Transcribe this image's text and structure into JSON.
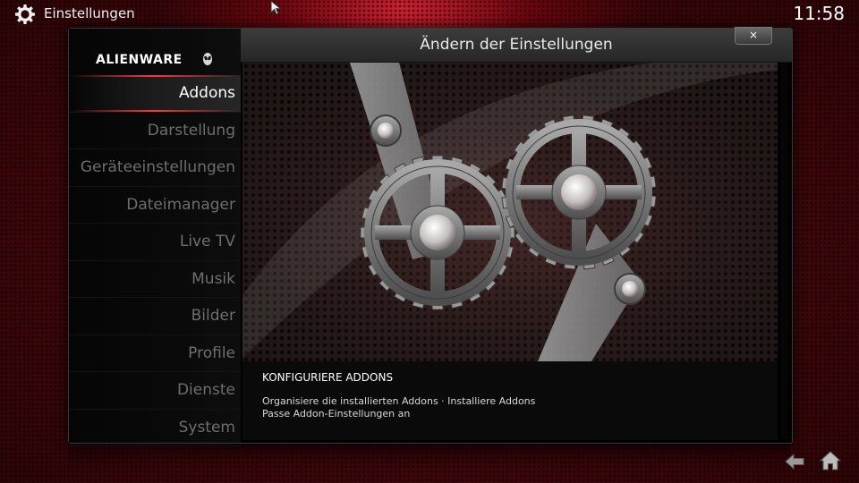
{
  "window": {
    "title": "Einstellungen",
    "clock": "11:58"
  },
  "brand": {
    "logo_text": "ALIENWARE",
    "accent_color": "#ff3838"
  },
  "sidebar": {
    "items": [
      {
        "label": "Addons",
        "active": true
      },
      {
        "label": "Darstellung",
        "active": false
      },
      {
        "label": "Geräteeinstellungen",
        "active": false
      },
      {
        "label": "Dateimanager",
        "active": false
      },
      {
        "label": "Live TV",
        "active": false
      },
      {
        "label": "Musik",
        "active": false
      },
      {
        "label": "Bilder",
        "active": false
      },
      {
        "label": "Profile",
        "active": false
      },
      {
        "label": "Dienste",
        "active": false
      },
      {
        "label": "System",
        "active": false
      }
    ]
  },
  "dialog": {
    "title": "Ändern der Einstellungen",
    "close_label": "×"
  },
  "description": {
    "title": "KONFIGURIERE ADDONS",
    "line1": "Organisiere die installierten Addons · Installiere Addons",
    "line2": "Passe Addon-Einstellungen an"
  },
  "icons": {
    "top_left": "settings-gear-icon",
    "artwork": "gears-artwork",
    "bottom_back": "back-arrow-icon",
    "bottom_home": "home-icon"
  }
}
